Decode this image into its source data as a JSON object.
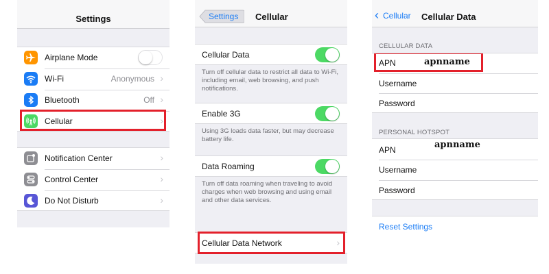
{
  "settings_panel": {
    "title": "Settings",
    "items": [
      {
        "label": "Airplane Mode",
        "value": ""
      },
      {
        "label": "Wi-Fi",
        "value": "Anonymous"
      },
      {
        "label": "Bluetooth",
        "value": "Off"
      },
      {
        "label": "Cellular",
        "value": ""
      },
      {
        "label": "Notification Center",
        "value": ""
      },
      {
        "label": "Control Center",
        "value": ""
      },
      {
        "label": "Do Not Disturb",
        "value": ""
      }
    ],
    "icon_colors": {
      "airplane": "#ff9500",
      "wifi": "#1a7cf5",
      "bluetooth": "#1a7cf5",
      "cellular": "#4cd964",
      "notification": "#8e8e93",
      "control": "#8e8e93",
      "dnd": "#5856d6"
    }
  },
  "cellular_panel": {
    "back_label": "Settings",
    "title": "Cellular",
    "cellular_data_label": "Cellular Data",
    "cellular_data_note": "Turn off cellular data to restrict all data to Wi-Fi, including email, web browsing, and push notifications.",
    "enable_3g_label": "Enable 3G",
    "enable_3g_note": "Using 3G loads data faster, but may decrease battery life.",
    "data_roaming_label": "Data Roaming",
    "data_roaming_note": "Turn off data roaming when traveling to avoid charges when web browsing and using email and other data services.",
    "network_label": "Cellular Data Network"
  },
  "cellular_data_panel": {
    "back_label": "Cellular",
    "title": "Cellular Data",
    "section_cellular": "CELLULAR DATA",
    "section_hotspot": "PERSONAL HOTSPOT",
    "apn_label": "APN",
    "username_label": "Username",
    "password_label": "Password",
    "apn_value_cellular": "apnname",
    "apn_value_hotspot": "apnname",
    "reset_label": "Reset Settings"
  },
  "colors": {
    "accent_blue": "#1a7cf5",
    "switch_on": "#4cd964",
    "highlight_red": "#e3202b"
  }
}
